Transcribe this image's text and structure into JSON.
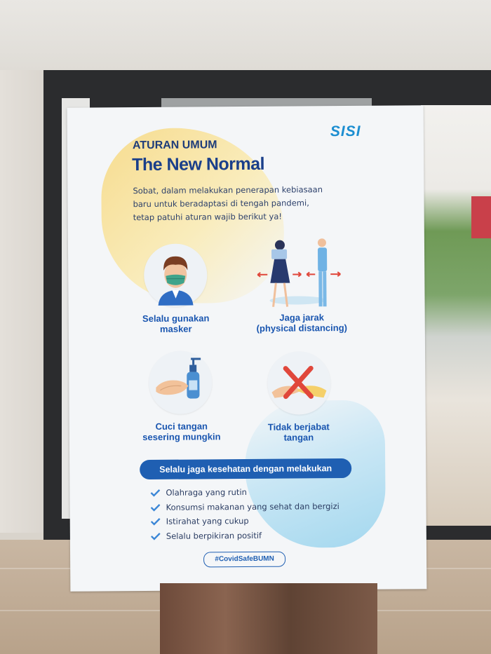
{
  "poster": {
    "logo": "SISI",
    "subtitle": "ATURAN UMUM",
    "title": "The New Normal",
    "intro_lines": [
      "Sobat, dalam melakukan penerapan kebiasaan",
      "baru untuk beradaptasi di tengah pandemi,",
      "tetap patuhi aturan wajib berikut ya!"
    ],
    "rules": [
      {
        "icon": "mask-person-icon",
        "lines": [
          "Selalu gunakan",
          "masker"
        ]
      },
      {
        "icon": "physical-distancing-icon",
        "lines": [
          "Jaga jarak",
          "(physical distancing)"
        ]
      },
      {
        "icon": "hand-washing-icon",
        "lines": [
          "Cuci tangan",
          "sesering mungkin"
        ]
      },
      {
        "icon": "no-handshake-icon",
        "lines": [
          "Tidak berjabat",
          "tangan"
        ]
      }
    ],
    "banner": "Selalu jaga kesehatan dengan melakukan",
    "checklist": [
      "Olahraga yang rutin",
      "Konsumsi makanan yang sehat dan bergizi",
      "Istirahat yang cukup",
      "Selalu berpikiran positif"
    ],
    "hashtag": "#CovidSafeBUMN"
  },
  "colors": {
    "primary_blue": "#1f5fb2",
    "logo_blue": "#1c8ed1",
    "accent_yellow": "#f7d36b",
    "cross_red": "#e0473b"
  }
}
